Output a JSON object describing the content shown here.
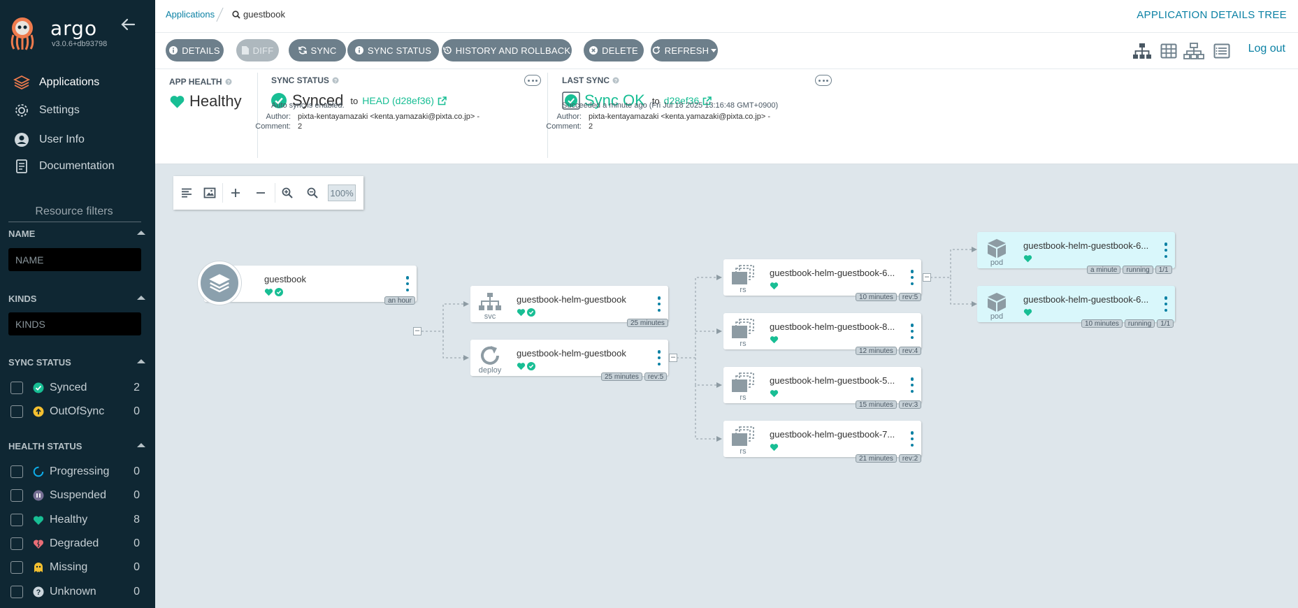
{
  "app": {
    "brand": "argo",
    "version": "v3.0.6+db93798",
    "title": "APPLICATION DETAILS TREE"
  },
  "breadcrumb": {
    "root": "Applications",
    "current": "guestbook"
  },
  "nav": [
    {
      "label": "Applications",
      "icon": "layers-icon",
      "active": true
    },
    {
      "label": "Settings",
      "icon": "gear-icon"
    },
    {
      "label": "User Info",
      "icon": "user-icon"
    },
    {
      "label": "Documentation",
      "icon": "book-icon"
    }
  ],
  "filters": {
    "title": "Resource filters",
    "name_head": "NAME",
    "name_placeholder": "NAME",
    "kinds_head": "KINDS",
    "kinds_placeholder": "KINDS",
    "sync_head": "SYNC STATUS",
    "sync_items": [
      {
        "label": "Synced",
        "count": "2",
        "icon": "check-circle-icon",
        "color": "#18be94"
      },
      {
        "label": "OutOfSync",
        "count": "0",
        "icon": "arrow-up-circle-icon",
        "color": "#f4c030"
      }
    ],
    "health_head": "HEALTH STATUS",
    "health_items": [
      {
        "label": "Progressing",
        "count": "0",
        "icon": "progress-ring-icon",
        "color": "#0dadea"
      },
      {
        "label": "Suspended",
        "count": "0",
        "icon": "pause-circle-icon",
        "color": "#766f94"
      },
      {
        "label": "Healthy",
        "count": "8",
        "icon": "heart-icon",
        "color": "#18be94"
      },
      {
        "label": "Degraded",
        "count": "0",
        "icon": "heart-broken-icon",
        "color": "#e96d76"
      },
      {
        "label": "Missing",
        "count": "0",
        "icon": "ghost-icon",
        "color": "#f4c030"
      },
      {
        "label": "Unknown",
        "count": "0",
        "icon": "question-circle-icon",
        "color": "#ccd6dd"
      }
    ]
  },
  "toolbar": {
    "details": "DETAILS",
    "diff": "DIFF",
    "sync": "SYNC",
    "sync_status": "SYNC STATUS",
    "history": "HISTORY AND ROLLBACK",
    "delete": "DELETE",
    "refresh": "REFRESH",
    "logout": "Log out"
  },
  "status": {
    "app_health_label": "APP HEALTH",
    "app_health_value": "Healthy",
    "sync_status_label": "SYNC STATUS",
    "sync_status_value": "Synced",
    "sync_to": "to",
    "sync_rev": "HEAD (d28ef36)",
    "auto_sync": "Auto sync is enabled.",
    "author_key": "Author:",
    "author_value": "pixta-kentayamazaki <kenta.yamazaki@pixta.co.jp> -",
    "comment_key": "Comment:",
    "comment_value": "2",
    "last_sync_label": "LAST SYNC",
    "last_sync_value": "Sync OK",
    "last_sync_to": "to",
    "last_sync_rev": "d28ef36",
    "last_sync_detail": "Succeeded a minute ago (Fri Jul 18 2025 13:16:48 GMT+0900)",
    "last_author_value": "pixta-kentayamazaki <kenta.yamazaki@pixta.co.jp> -",
    "last_comment_value": "2"
  },
  "graph": {
    "zoom": "100%",
    "app_node": {
      "name": "guestbook",
      "tags": [
        "an hour"
      ]
    },
    "svc_node": {
      "name": "guestbook-helm-guestbook",
      "kind": "svc",
      "tags": [
        "25 minutes"
      ]
    },
    "deploy_node": {
      "name": "guestbook-helm-guestbook",
      "kind": "deploy",
      "tags": [
        "25 minutes",
        "rev:5"
      ]
    },
    "rs_nodes": [
      {
        "name": "guestbook-helm-guestbook-6...",
        "kind": "rs",
        "tags": [
          "10 minutes",
          "rev:5"
        ]
      },
      {
        "name": "guestbook-helm-guestbook-8...",
        "kind": "rs",
        "tags": [
          "12 minutes",
          "rev:4"
        ]
      },
      {
        "name": "guestbook-helm-guestbook-5...",
        "kind": "rs",
        "tags": [
          "15 minutes",
          "rev:3"
        ]
      },
      {
        "name": "guestbook-helm-guestbook-7...",
        "kind": "rs",
        "tags": [
          "21 minutes",
          "rev:2"
        ]
      }
    ],
    "pod_nodes": [
      {
        "name": "guestbook-helm-guestbook-6...",
        "kind": "pod",
        "tags": [
          "a minute",
          "running",
          "1/1"
        ]
      },
      {
        "name": "guestbook-helm-guestbook-6...",
        "kind": "pod",
        "tags": [
          "10 minutes",
          "running",
          "1/1"
        ]
      }
    ],
    "collapse_symbol": "–"
  },
  "colors": {
    "accent": "#0b81a4",
    "healthy": "#18be94",
    "sidebar": "#0f2733",
    "canvas": "#dee6eb"
  }
}
